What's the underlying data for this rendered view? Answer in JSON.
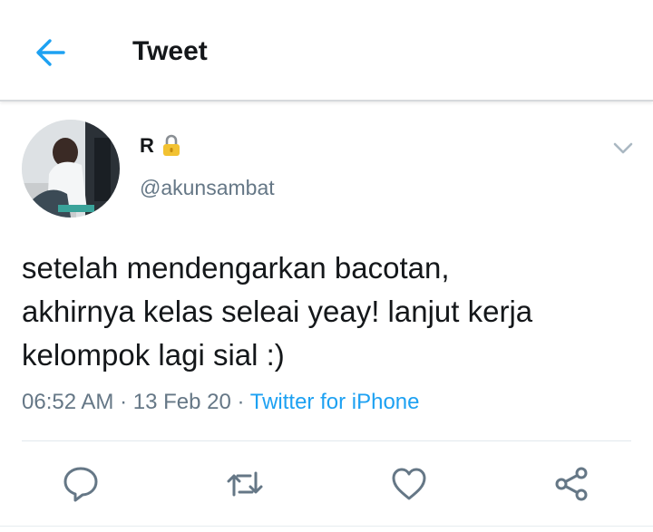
{
  "header": {
    "title": "Tweet",
    "back_icon": "arrow-left-icon"
  },
  "user": {
    "name": "R",
    "lock_icon": "lock-icon",
    "handle": "@akunsambat"
  },
  "tweet": {
    "lines": [
      "setelah mendengarkan bacotan,",
      "akhirnya kelas seleai yeay! lanjut kerja",
      "kelompok lagi sial :)"
    ],
    "time": "06:52 AM",
    "date": "13 Feb 20",
    "separator": "·",
    "source": "Twitter for iPhone"
  },
  "actions": [
    "reply-icon",
    "retweet-icon",
    "like-icon",
    "share-icon"
  ],
  "colors": {
    "accent": "#1da1f2",
    "muted": "#657786",
    "text": "#14171a",
    "lock": "#e8b21a"
  }
}
